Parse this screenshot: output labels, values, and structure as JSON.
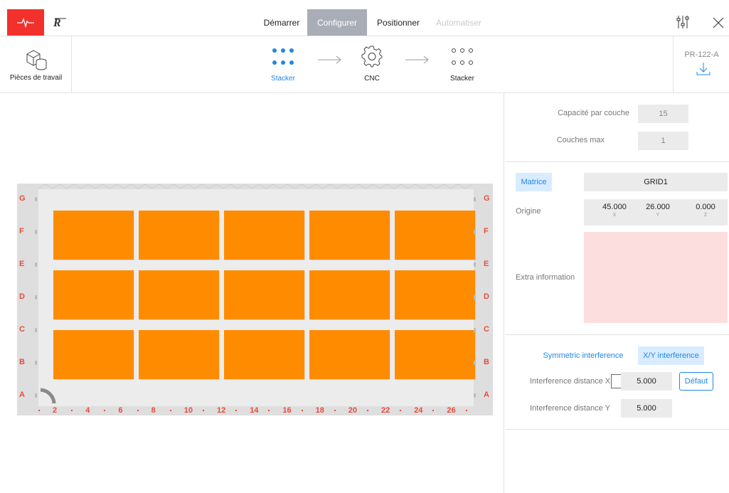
{
  "nav": {
    "tabs": [
      {
        "label": "Démarrer",
        "state": "normal"
      },
      {
        "label": "Configurer",
        "state": "active"
      },
      {
        "label": "Positionner",
        "state": "normal"
      },
      {
        "label": "Automatiser",
        "state": "disabled"
      }
    ],
    "icons": {
      "brand": "pulse-icon",
      "robot": "robot-logo-icon",
      "settings": "sliders-icon",
      "close": "close-icon"
    }
  },
  "flow": {
    "workpieces_label": "Pièces de travail",
    "steps": [
      {
        "label": "Stacker",
        "icon": "dots-grid-icon",
        "active": true
      },
      {
        "label": "CNC",
        "icon": "gear-icon",
        "active": false
      },
      {
        "label": "Stacker",
        "icon": "dots-grid-icon",
        "active": false
      }
    ],
    "program_name": "PR-122-A"
  },
  "grid": {
    "row_labels": [
      "G",
      "F",
      "E",
      "D",
      "C",
      "B",
      "A"
    ],
    "col_labels": [
      "2",
      "4",
      "6",
      "8",
      "10",
      "12",
      "14",
      "16",
      "18",
      "20",
      "22",
      "24",
      "26"
    ],
    "rows": 3,
    "cols": 5,
    "cell_color": "#ff8c00",
    "label_color": "#e74c3c"
  },
  "panel": {
    "capacity_label": "Capacité par couche",
    "capacity_value": "15",
    "layers_label": "Couches max",
    "layers_value": "1",
    "matrix_label": "Matrice",
    "matrix_value": "GRID1",
    "origin_label": "Origine",
    "origin": {
      "x": "45.000",
      "x_unit": "X",
      "y": "26.000",
      "y_unit": "Y",
      "z": "0.000",
      "z_unit": "Z"
    },
    "extra_label": "Extra information",
    "sym_tab": "Symmetric interference",
    "xy_tab": "X/Y interference",
    "dist_x_label": "Interference distance X",
    "dist_x_value": "5.000",
    "default_label": "Défaut",
    "dist_y_label": "Interference distance Y",
    "dist_y_value": "5.000"
  }
}
